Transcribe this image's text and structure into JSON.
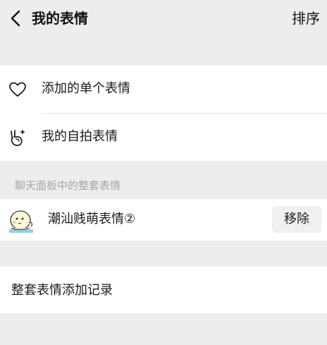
{
  "nav": {
    "title": "我的表情",
    "sort_label": "排序",
    "back_icon": "chevron-left-icon"
  },
  "menu": {
    "items": [
      {
        "label": "添加的单个表情",
        "icon": "heart-outline-icon"
      },
      {
        "label": "我的自拍表情",
        "icon": "selfie-hand-sparkle-icon"
      }
    ]
  },
  "section": {
    "title": "聊天面板中的整套表情"
  },
  "packs": [
    {
      "label": "潮汕贱萌表情②",
      "action_label": "移除",
      "icon": "pack-thumbnail"
    }
  ],
  "history": {
    "label": "整套表情添加记录"
  },
  "colors": {
    "background": "#ededed",
    "card": "#ffffff",
    "section_text": "#a6a6a6",
    "button_bg": "#f0f0f0"
  }
}
